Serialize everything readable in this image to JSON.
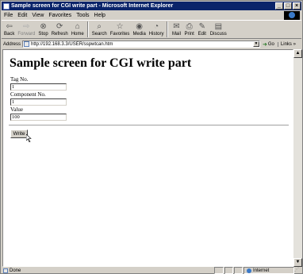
{
  "window": {
    "title": "Sample screen for CGI write part - Microsoft Internet Explorer"
  },
  "menu": [
    "File",
    "Edit",
    "View",
    "Favorites",
    "Tools",
    "Help"
  ],
  "toolbar": {
    "buttons": [
      {
        "label": "Back",
        "icon": "back-arrow-icon"
      },
      {
        "label": "Forward",
        "icon": "forward-arrow-icon"
      },
      {
        "label": "Stop",
        "icon": "stop-icon"
      },
      {
        "label": "Refresh",
        "icon": "refresh-icon"
      },
      {
        "label": "Home",
        "icon": "home-icon"
      },
      {
        "label": "Search",
        "icon": "search-icon"
      },
      {
        "label": "Favorites",
        "icon": "favorites-icon"
      },
      {
        "label": "Media",
        "icon": "media-icon"
      },
      {
        "label": "History",
        "icon": "history-icon"
      },
      {
        "label": "Mail",
        "icon": "mail-icon"
      },
      {
        "label": "Print",
        "icon": "print-icon"
      },
      {
        "label": "Edit",
        "icon": "edit-icon"
      },
      {
        "label": "Discuss",
        "icon": "discuss-icon"
      }
    ]
  },
  "address": {
    "label": "Address",
    "url": "http://192.168.3.3/USER/sspwtcan.htm",
    "go_label": "Go",
    "links_label": "Links »"
  },
  "page": {
    "title": "Sample screen for CGI write part",
    "fields": [
      {
        "label": "Tag No.",
        "value": "1"
      },
      {
        "label": "Component No.",
        "value": "1"
      },
      {
        "label": "Value",
        "value": "100"
      }
    ],
    "write_label": "Write"
  },
  "status": {
    "text": "Done",
    "zone": "Internet"
  }
}
